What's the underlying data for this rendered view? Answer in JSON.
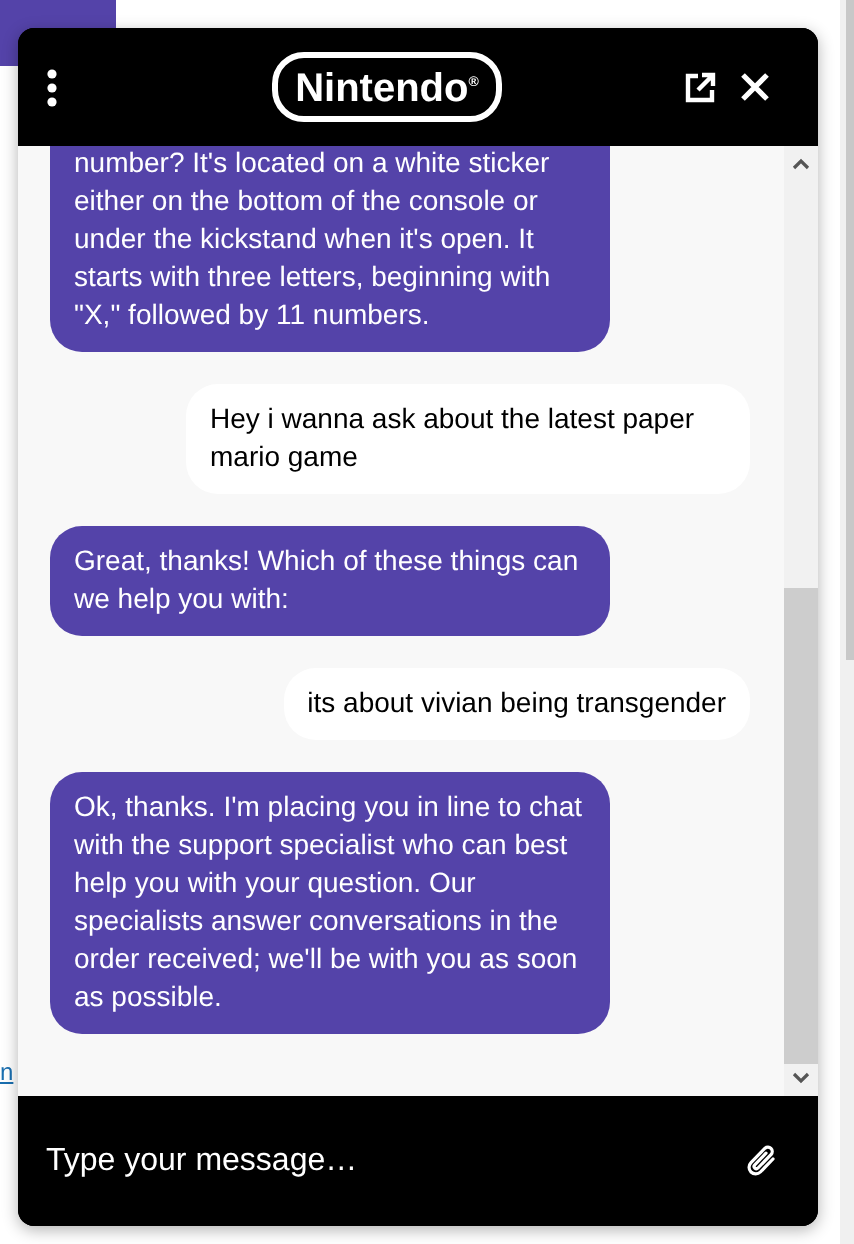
{
  "page": {
    "link": "n"
  },
  "chat": {
    "title": "Nintendo$^{®}$",
    "messages": [
      {
        "kind": "agent",
        "text": "number? It's located on a white sticker either on the bottom of the console or under the kickstand when it's open. It starts with three letters, beginning with \"X,\" followed by 11 numbers."
      },
      {
        "kind": "user",
        "text": "Hey i wanna ask about the latest paper mario game"
      },
      {
        "kind": "agent",
        "text": "Great, thanks! Which of these things can we help you with:"
      },
      {
        "kind": "user",
        "text": "its about vivian being transgender"
      },
      {
        "kind": "agent",
        "text": "Ok, thanks. I'm placing you in line to chat with the support specialist who can best help you with your question. Our specialists answer conversations in the order received; we'll be with you as soon as possible."
      }
    ],
    "composer": {
      "placeholder": "Type your message…"
    }
  }
}
